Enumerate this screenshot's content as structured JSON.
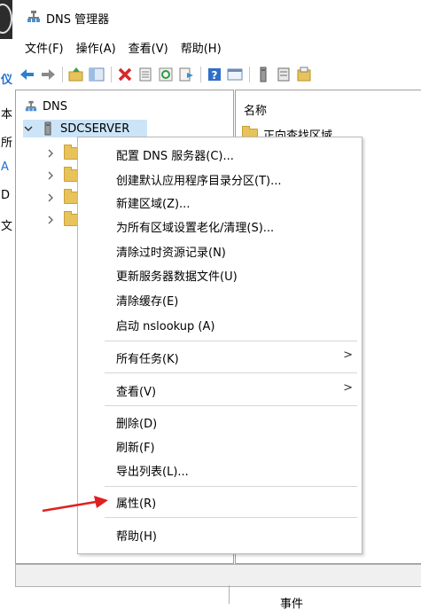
{
  "window": {
    "title": "DNS 管理器"
  },
  "left_strip": {
    "chars": [
      "仪",
      "本",
      "所",
      "A",
      "D",
      "文"
    ]
  },
  "menubar": {
    "items": [
      "文件(F)",
      "操作(A)",
      "查看(V)",
      "帮助(H)"
    ]
  },
  "toolbar": {
    "icons": [
      "back-arrow-icon",
      "forward-arrow-icon",
      "up-folder-icon",
      "show-hide-console-tree-icon",
      "delete-icon",
      "properties-icon",
      "refresh-icon",
      "export-list-icon",
      "help-icon",
      "console-view-icon",
      "server-icon",
      "list-icon",
      "zone-icon"
    ],
    "colors": {
      "back": "#2f7fd0",
      "forward": "#8a8a8a",
      "delete": "#d8262b",
      "help": "#2f6fc8"
    }
  },
  "tree": {
    "root_label": "DNS",
    "server_label": "SDCSERVER"
  },
  "list_panel": {
    "column_header": "名称",
    "first_item": "正向查找区域"
  },
  "context_menu": {
    "items": [
      "配置 DNS 服务器(C)...",
      "创建默认应用程序目录分区(T)...",
      "新建区域(Z)...",
      "为所有区域设置老化/清理(S)...",
      "清除过时资源记录(N)",
      "更新服务器数据文件(U)",
      "清除缓存(E)",
      "启动 nslookup (A)",
      "所有任务(K)",
      "查看(V)",
      "删除(D)",
      "刷新(F)",
      "导出列表(L)...",
      "属性(R)",
      "帮助(H)"
    ],
    "submenu_arrow": ">"
  },
  "bottom": {
    "partial_text": "事件"
  },
  "annotation": {
    "arrow_color": "#e02020"
  }
}
